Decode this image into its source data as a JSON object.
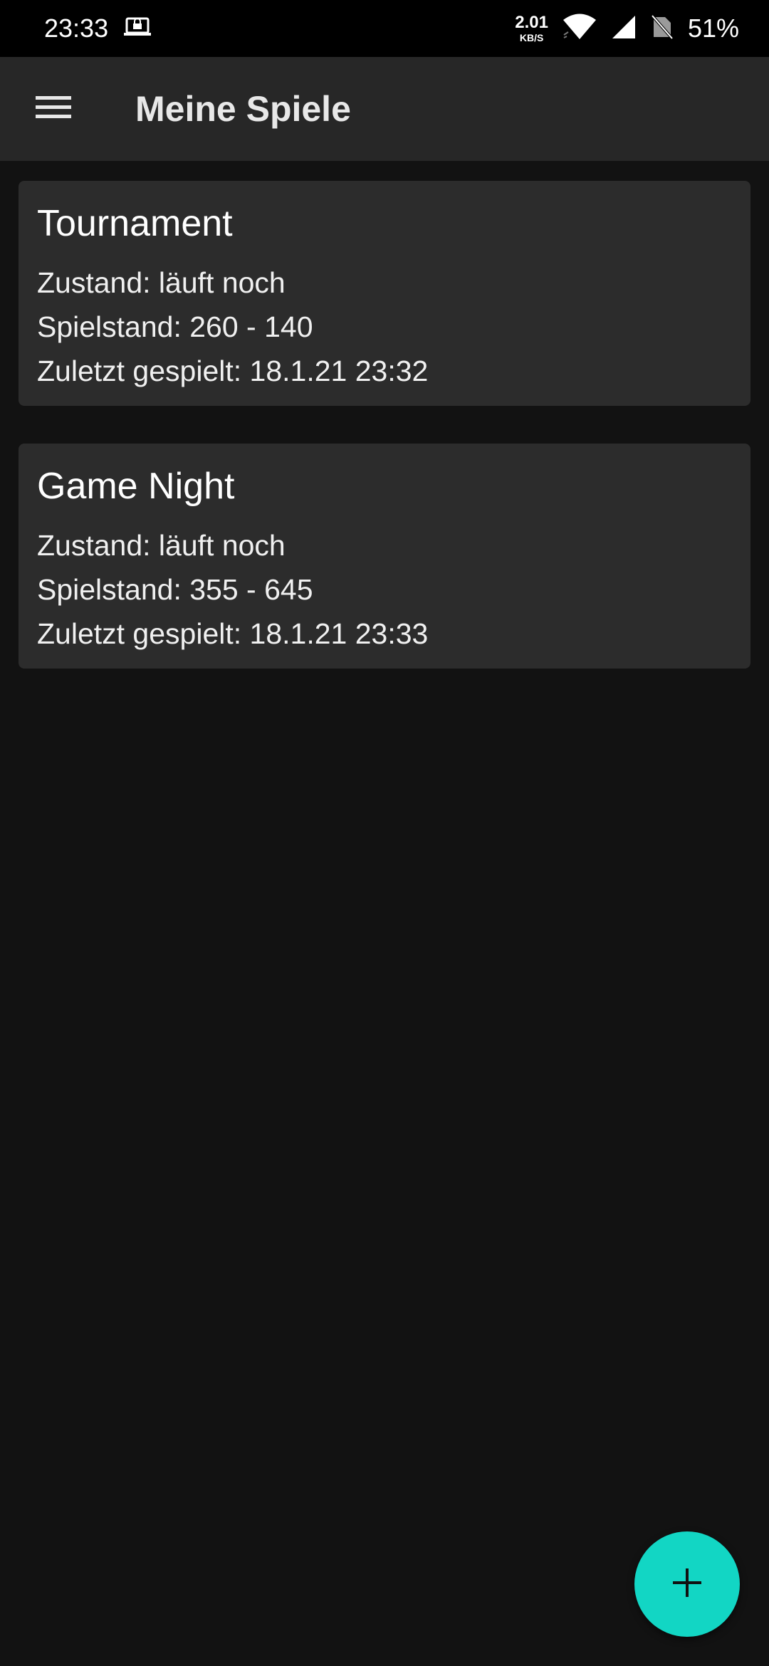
{
  "status_bar": {
    "time": "23:33",
    "net_speed_value": "2.01",
    "net_speed_unit": "KB/S",
    "battery": "51%"
  },
  "app_bar": {
    "title": "Meine Spiele"
  },
  "games": [
    {
      "name": "Tournament",
      "state": "Zustand: läuft noch",
      "score": "Spielstand: 260 - 140",
      "last_played": "Zuletzt gespielt: 18.1.21 23:32"
    },
    {
      "name": "Game Night",
      "state": "Zustand: läuft noch",
      "score": "Spielstand: 355 - 645",
      "last_played": "Zuletzt gespielt: 18.1.21 23:33"
    }
  ],
  "fab": {
    "icon": "plus-icon",
    "color": "#12d6c4"
  }
}
